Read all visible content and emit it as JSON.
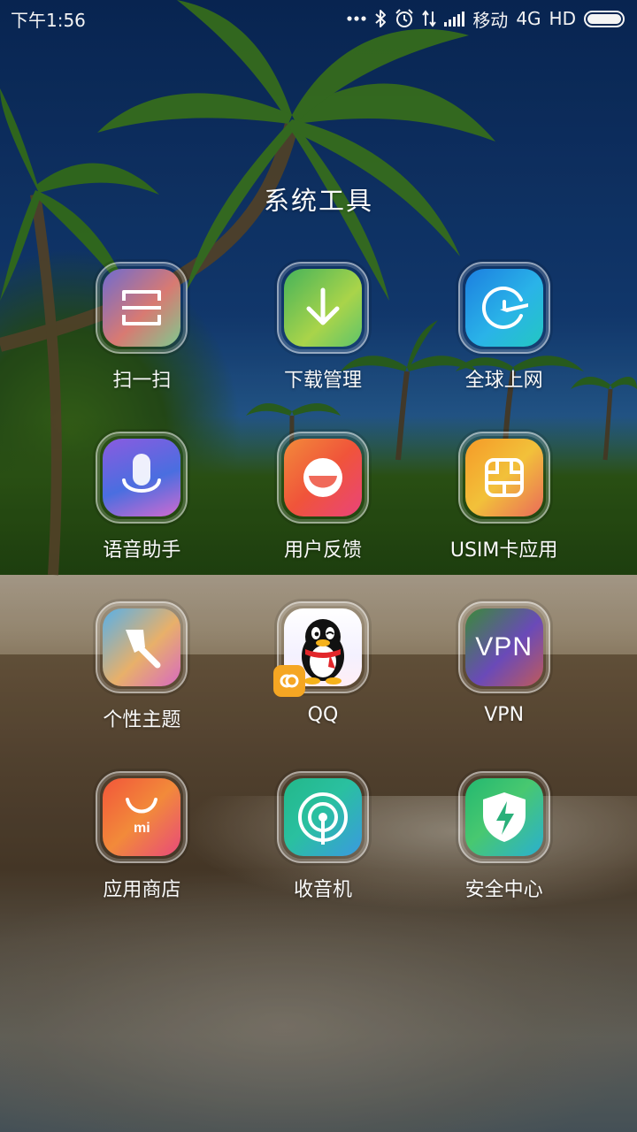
{
  "status_bar": {
    "time": "下午1:56",
    "carrier": "移动",
    "network": "4G",
    "hd": "HD",
    "icons": [
      "more-dots-icon",
      "bluetooth-icon",
      "alarm-icon",
      "data-transfer-icon",
      "signal-icon",
      "battery-icon"
    ],
    "battery_level": 1.0
  },
  "folder": {
    "title": "系统工具",
    "apps": [
      {
        "label": "扫一扫",
        "icon": "scanner-icon",
        "colors": [
          "#6f6bd0",
          "#d87a72",
          "#7fc98f"
        ]
      },
      {
        "label": "下载管理",
        "icon": "download-arrow-icon",
        "colors": [
          "#5dc06a",
          "#a9d44a",
          "#43a94e"
        ]
      },
      {
        "label": "全球上网",
        "icon": "global-plane-icon",
        "colors": [
          "#1c7fe0",
          "#2ab3e8",
          "#23c7c2"
        ]
      },
      {
        "label": "语音助手",
        "icon": "microphone-icon",
        "colors": [
          "#6a53d8",
          "#3a6ed8",
          "#d06ad0"
        ]
      },
      {
        "label": "用户反馈",
        "icon": "smile-icon",
        "colors": [
          "#f06a3a",
          "#e9447a",
          "#f59a3a"
        ]
      },
      {
        "label": "USIM卡应用",
        "icon": "sim-card-icon",
        "colors": [
          "#f59a28",
          "#f2c13a",
          "#ea6a5a"
        ]
      },
      {
        "label": "个性主题",
        "icon": "paintbrush-icon",
        "colors": [
          "#58b0e8",
          "#e8b06a",
          "#d86ac0"
        ]
      },
      {
        "label": "QQ",
        "icon": "qq-penguin-icon",
        "colors": [
          "#ffffff",
          "#f2f0ff",
          "#ffe8f0"
        ]
      },
      {
        "label": "VPN",
        "icon": "vpn-text-icon",
        "colors": [
          "#3a8a3a",
          "#6a4ab8",
          "#c05a5a"
        ],
        "text": "VPN"
      },
      {
        "label": "应用商店",
        "icon": "app-store-bag-icon",
        "colors": [
          "#f2563a",
          "#f28a3a",
          "#e84a7a"
        ],
        "text": "mi"
      },
      {
        "label": "收音机",
        "icon": "radio-icon",
        "colors": [
          "#23b88a",
          "#3a9ae0",
          "#2ac0a0"
        ]
      },
      {
        "label": "安全中心",
        "icon": "security-shield-icon",
        "colors": [
          "#23b870",
          "#2ab0d0",
          "#48c870"
        ]
      }
    ]
  }
}
